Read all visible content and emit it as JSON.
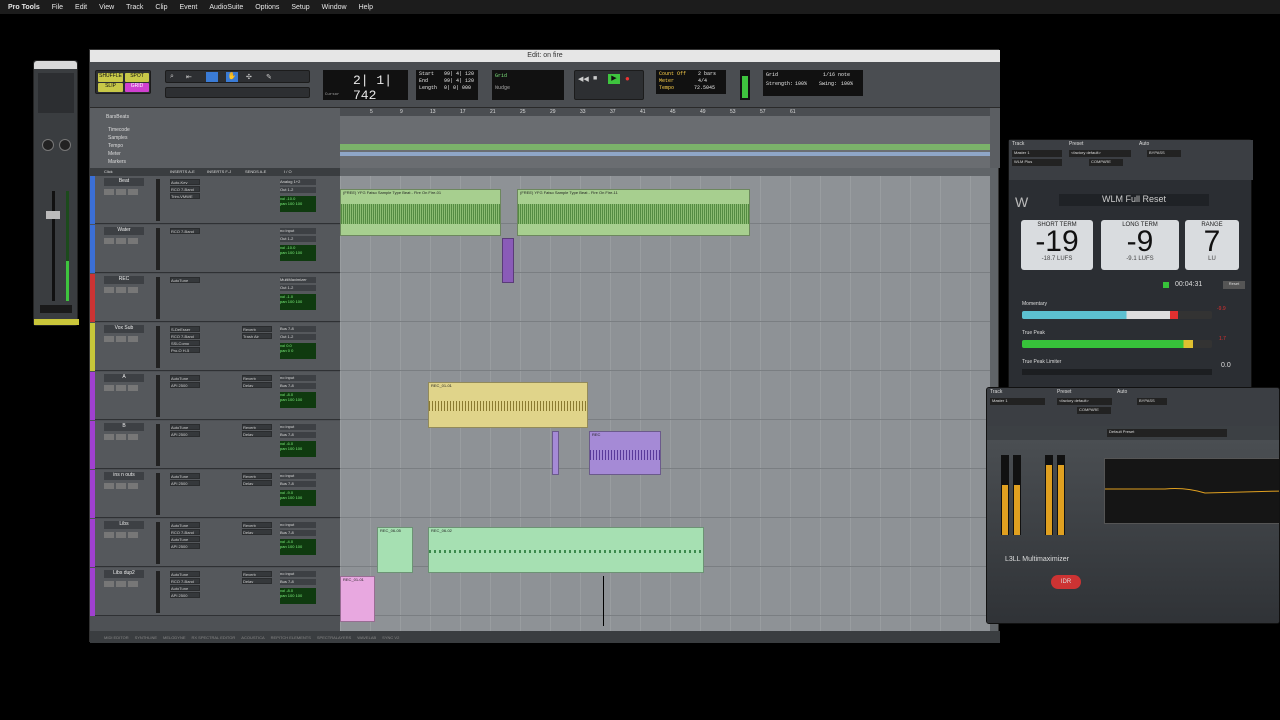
{
  "menubar": {
    "items": [
      "Pro Tools",
      "File",
      "Edit",
      "View",
      "Track",
      "Clip",
      "Event",
      "AudioSuite",
      "Options",
      "Setup",
      "Window",
      "Help"
    ]
  },
  "edit_window": {
    "title": "Edit: on fire",
    "modes": {
      "shuffle": "SHUFFLE",
      "spot": "SPOT",
      "slip": "SLIP",
      "grid": "GRID"
    },
    "main_counter": "2| 1| 742",
    "sub_counter_label": "Cursor",
    "start_label": "Start",
    "end_label": "End",
    "length_label": "Length",
    "start_val": "99| 4| 120",
    "end_val": "99| 4| 120",
    "length_val": "0| 0| 000",
    "nudge_label": "Nudge",
    "grid_label": "Grid",
    "grid_value": "1/16 note",
    "strength_label": "Strength:",
    "strength_value": "100%",
    "swing_label": "Swing:",
    "swing_value": "100%",
    "count_off": "Count Off",
    "meter_label": "Meter",
    "tempo_label": "Tempo",
    "tempo_value": "72.5045",
    "bars": "2 bars",
    "meter_value": "4/4",
    "session_name": "BarsBeats",
    "ruler_names": [
      "Timecode",
      "Samples",
      "Tempo",
      "Meter",
      "Markers"
    ],
    "bar_numbers": [
      "5",
      "9",
      "13",
      "17",
      "21",
      "25",
      "29",
      "33",
      "37",
      "41",
      "45",
      "49",
      "53",
      "57",
      "61"
    ],
    "click_label": "Click",
    "column_headers": [
      "INSERTS A-E",
      "INSERTS F-J",
      "SENDS A-E",
      "I / O"
    ]
  },
  "tracks": [
    {
      "name": "Beat",
      "color": "#3b6fd6",
      "inserts": [
        "Auto-Key",
        "RCQ 7-Band",
        "Trim-VMWE"
      ],
      "sends": [],
      "io_in": "Analog 1+2",
      "io_out": "Out 1-2",
      "vol": "vol -10.0",
      "pan": "pan 100 100"
    },
    {
      "name": "Water",
      "color": "#3b6fd6",
      "inserts": [
        "RCQ 7-Band"
      ],
      "sends": [],
      "io_in": "no input",
      "io_out": "Out 1-2",
      "vol": "vol -10.0",
      "pan": "pan 100 100"
    },
    {
      "name": "REC",
      "color": "#c33",
      "inserts": [
        "AutoTune"
      ],
      "sends": [],
      "io_in": "MultiMaximizer",
      "io_out": "Out 1-2",
      "vol": "vol -1.0",
      "pan": "pan 100 100"
    },
    {
      "name": "Vox Sub",
      "color": "#c7c73a",
      "inserts": [
        "S-DeEsser",
        "RCQ 7-Band",
        "SSLComp",
        "Pro-Q H-5"
      ],
      "sends": [
        "Reverb",
        "Trash Air"
      ],
      "io_in": "Bus 7-8",
      "io_out": "Out 1-2",
      "vol": "vol 0.0",
      "pan": "pan 0 0"
    },
    {
      "name": "A",
      "color": "#a040d0",
      "inserts": [
        "AutoTune",
        "API 2500"
      ],
      "sends": [
        "Reverb",
        "Delay"
      ],
      "io_in": "no input",
      "io_out": "Bus 7-8",
      "vol": "vol -8.0",
      "pan": "pan 100 100"
    },
    {
      "name": "B",
      "color": "#a040d0",
      "inserts": [
        "AutoTune",
        "API 2500"
      ],
      "sends": [
        "Reverb",
        "Delay"
      ],
      "io_in": "no input",
      "io_out": "Bus 7-8",
      "vol": "vol -6.0",
      "pan": "pan 100 100"
    },
    {
      "name": "ins n outs",
      "color": "#a040d0",
      "inserts": [
        "AutoTune",
        "API 2500"
      ],
      "sends": [
        "Reverb",
        "Delay"
      ],
      "io_in": "no input",
      "io_out": "Bus 7-8",
      "vol": "vol -9.0",
      "pan": "pan 100 100"
    },
    {
      "name": "Libs",
      "color": "#a040d0",
      "inserts": [
        "AutoTune",
        "RCQ 7-Band",
        "AutoTune",
        "API 2500"
      ],
      "sends": [
        "Reverb",
        "Delay"
      ],
      "io_in": "no input",
      "io_out": "Bus 7-8",
      "vol": "vol -4.0",
      "pan": "pan 100 100"
    },
    {
      "name": "Libs dup2",
      "color": "#a040d0",
      "inserts": [
        "AutoTune",
        "RCQ 7-Band",
        "AutoTune",
        "API 2500"
      ],
      "sends": [
        "Reverb",
        "Delay"
      ],
      "io_in": "no input",
      "io_out": "Bus 7-8",
      "vol": "vol -8.0",
      "pan": "pan 100 100"
    }
  ],
  "clips": {
    "beat_1": "(FREE) YFG Fatso Sample Type Beat - Fire On Fire-01",
    "beat_2": "(FREE) YFG Fatso Sample Type Beat - Fire On Fire-11",
    "rec_a": "REC_01-01",
    "rec_b": "REC",
    "rec_libs_1": "REC_06-05",
    "rec_libs_2": "REC_06-02",
    "rec_dup": "REC_01-01"
  },
  "bottom_tabs": [
    "MIDI EDITOR",
    "SYNTHLINE",
    "MELODYNE",
    "RX SPECTRAL EDITOR",
    "ACOUSTICA",
    "REPITCH ELEMENTS",
    "SPECTRALAYERS",
    "WAVELAB",
    "SYNC V2"
  ],
  "wlm": {
    "track_label": "Track",
    "preset_label": "Preset",
    "auto_label": "Auto",
    "track_value": "Master 1",
    "preset_value": "<factory default>",
    "plugin_name": "WLM Plus",
    "bypass": "BYPASS",
    "compare": "COMPARE",
    "preset_title": "WLM Full Reset",
    "short_term_label": "SHORT TERM",
    "long_term_label": "LONG TERM",
    "range_label": "RANGE",
    "short_term_value": "-19",
    "long_term_value": "-9",
    "range_value": "7",
    "short_term_sub": "-18.7",
    "long_term_sub": "-9.1",
    "unit_lufs": "LUFS",
    "unit_lu": "LU",
    "time": "00:04:31",
    "reset": "Reset",
    "momentary_label": "Momentary",
    "momentary_val": "-9.9",
    "true_peak_label": "True Peak",
    "true_peak_val": "1.7",
    "limiter_label": "True Peak Limiter",
    "limiter_val": "0.0",
    "colors": {
      "green": "#37c23a",
      "red": "#e03030",
      "cyan": "#5cc0d0"
    }
  },
  "l3": {
    "track_label": "Track",
    "preset_label": "Preset",
    "auto_label": "Auto",
    "track_value": "Master 1",
    "preset_value": "<factory default>",
    "plugin_name": "L3 Multimaximizer",
    "preset_title": "Default Preset",
    "brand": "L3LL Multimaximizer",
    "bypass": "BYPASS",
    "compare": "COMPARE",
    "quantize": "IDR",
    "colors": {
      "accent": "#e0a020",
      "red": "#c33"
    }
  }
}
